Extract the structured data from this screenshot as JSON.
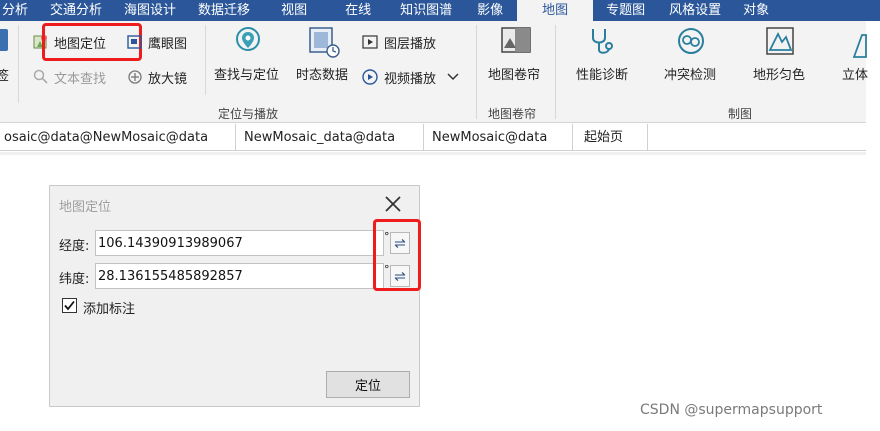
{
  "menu": {
    "items": [
      "分析",
      "交通分析",
      "海图设计",
      "数据迁移",
      "视图",
      "在线",
      "知识图谱",
      "影像",
      "地图",
      "专题图",
      "风格设置",
      "对象"
    ],
    "active": "地图"
  },
  "ribbon": {
    "cut_left_label": "签",
    "map_locate": "地图定位",
    "eagle_eye": "鹰眼图",
    "text_search": "文本查找",
    "magnifier": "放大镜",
    "find_locate": "查找与定位",
    "temporal_data": "时态数据",
    "layer_play": "图层播放",
    "video_play": "视频播放",
    "map_scroll": "地图卷帘",
    "perf_diag": "性能诊断",
    "conflict_detect": "冲突检测",
    "terrain_color": "地形匀色",
    "solid": "立体",
    "groups": {
      "locate_play": "定位与播放",
      "map_scroll": "地图卷帘",
      "mapping": "制图"
    }
  },
  "tabs": [
    "osaic@data@NewMosaic@data",
    "NewMosaic_data@data",
    "NewMosaic@data",
    "起始页"
  ],
  "dialog": {
    "title": "地图定位",
    "longitude_label": "经度:",
    "longitude_value": "106.14390913989067",
    "latitude_label": "纬度:",
    "latitude_value": "28.136155485892857",
    "unit": "°",
    "swap_symbol": "⇌",
    "add_label": "添加标注",
    "add_label_checked": true,
    "locate_button": "定位"
  },
  "watermark": "CSDN @supermapsupport",
  "colors": {
    "menubar": "#2b579a",
    "highlight": "#ee1c1c",
    "ribbon_bg": "#f3f3f3"
  }
}
